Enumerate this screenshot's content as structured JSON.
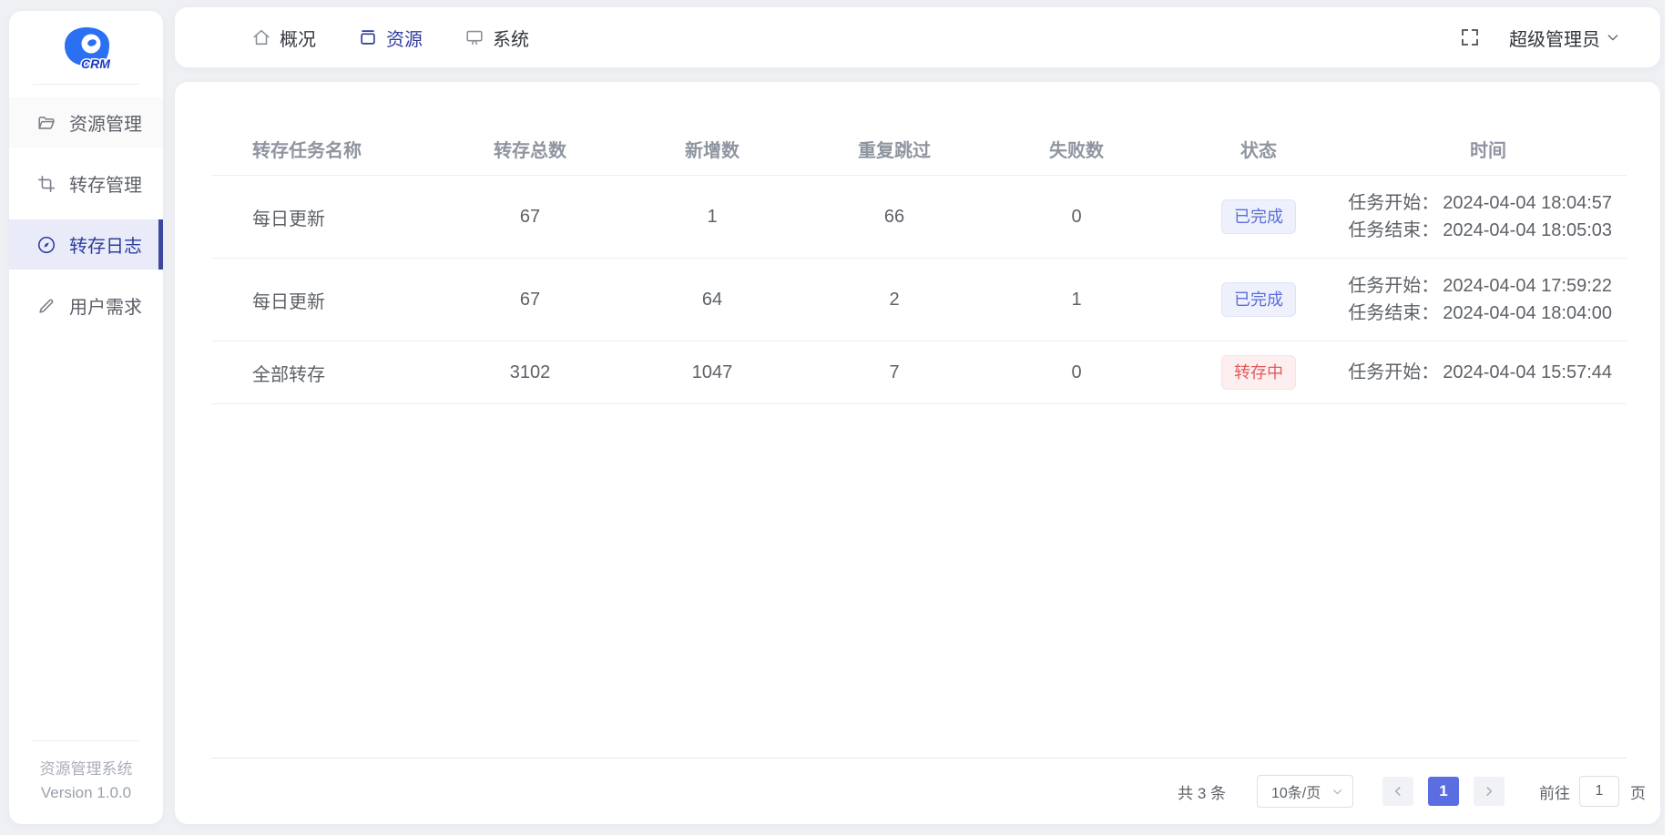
{
  "app": {
    "logo_text": "CRM",
    "footer_title": "资源管理系统",
    "footer_version": "Version 1.0.0"
  },
  "topbar": {
    "nav": [
      {
        "label": "概况"
      },
      {
        "label": "资源"
      },
      {
        "label": "系统"
      }
    ],
    "user_label": "超级管理员"
  },
  "sidebar": {
    "items": [
      {
        "label": "资源管理"
      },
      {
        "label": "转存管理"
      },
      {
        "label": "转存日志"
      },
      {
        "label": "用户需求"
      }
    ]
  },
  "table": {
    "columns": [
      "转存任务名称",
      "转存总数",
      "新增数",
      "重复跳过",
      "失败数",
      "状态",
      "时间"
    ],
    "rows": [
      {
        "name": "每日更新",
        "total": "67",
        "added": "1",
        "skipped": "66",
        "failed": "0",
        "status": "已完成",
        "status_type": "completed",
        "time_start_label": "任务开始：",
        "time_start": "2024-04-04 18:04:57",
        "time_end_label": "任务结束：",
        "time_end": "2024-04-04 18:05:03"
      },
      {
        "name": "每日更新",
        "total": "67",
        "added": "64",
        "skipped": "2",
        "failed": "1",
        "status": "已完成",
        "status_type": "completed",
        "time_start_label": "任务开始：",
        "time_start": "2024-04-04 17:59:22",
        "time_end_label": "任务结束：",
        "time_end": "2024-04-04 18:04:00"
      },
      {
        "name": "全部转存",
        "total": "3102",
        "added": "1047",
        "skipped": "7",
        "failed": "0",
        "status": "转存中",
        "status_type": "running",
        "time_start_label": "任务开始：",
        "time_start": "2024-04-04 15:57:44"
      }
    ]
  },
  "pagination": {
    "total_text": "共 3 条",
    "page_size": "10条/页",
    "current_page": "1",
    "goto_label": "前往",
    "goto_value": "1",
    "goto_suffix": "页"
  },
  "colors": {
    "page_bg": "#eef0f4",
    "accent_indigo": "#2c3c9e",
    "logo_blue": "#2b6ff2",
    "current_page_bg": "#5a6ee1",
    "badge_completed_text": "#5a6edd",
    "badge_completed_bg": "#eef1fb",
    "badge_running_text": "#e15c5c",
    "badge_running_bg": "#fdeef0"
  }
}
